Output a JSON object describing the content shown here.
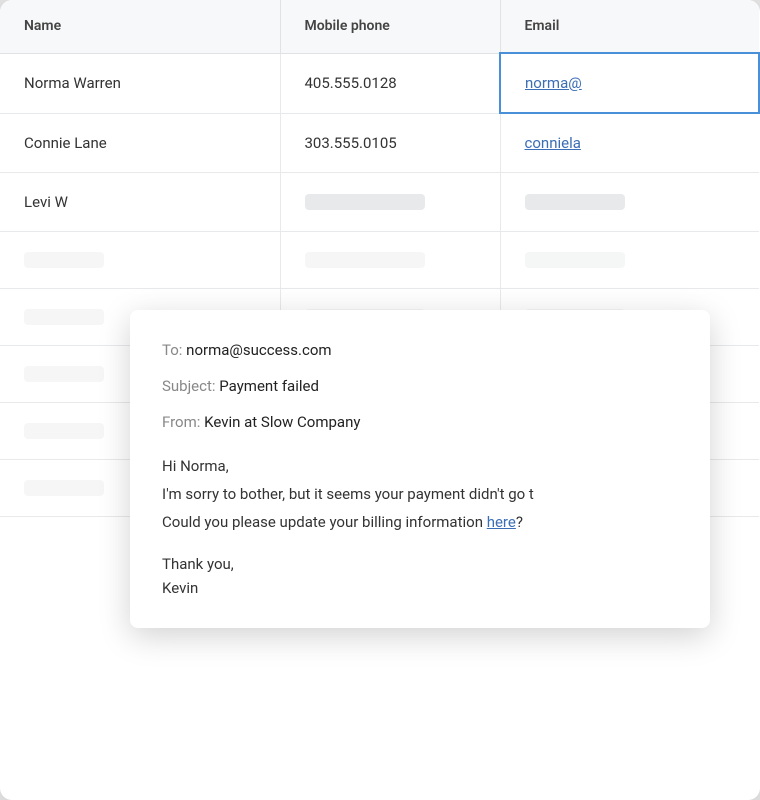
{
  "table": {
    "headers": [
      "Name",
      "Mobile phone",
      "Email"
    ],
    "rows": [
      {
        "name": "Norma Warren",
        "phone": "405.555.0128",
        "email": "norma@"
      },
      {
        "name": "Connie Lane",
        "phone": "303.555.0105",
        "email": "conniela"
      },
      {
        "name": "Levi W",
        "phone": "",
        "email": ""
      }
    ]
  },
  "popup": {
    "to_label": "To:",
    "to_value": "norma@success.com",
    "subject_label": "Subject:",
    "subject_value": "Payment failed",
    "from_label": "From:",
    "from_value": "Kevin at Slow Company",
    "body_greeting": "Hi Norma,",
    "body_line1": "I'm sorry to bother, but it seems your payment didn't go t",
    "body_line2_prefix": "Could you please update your billing information ",
    "body_link": "here",
    "body_line2_suffix": "?",
    "sign_line1": "Thank you,",
    "sign_line2": "Kevin"
  },
  "placeholder_rows": 5
}
